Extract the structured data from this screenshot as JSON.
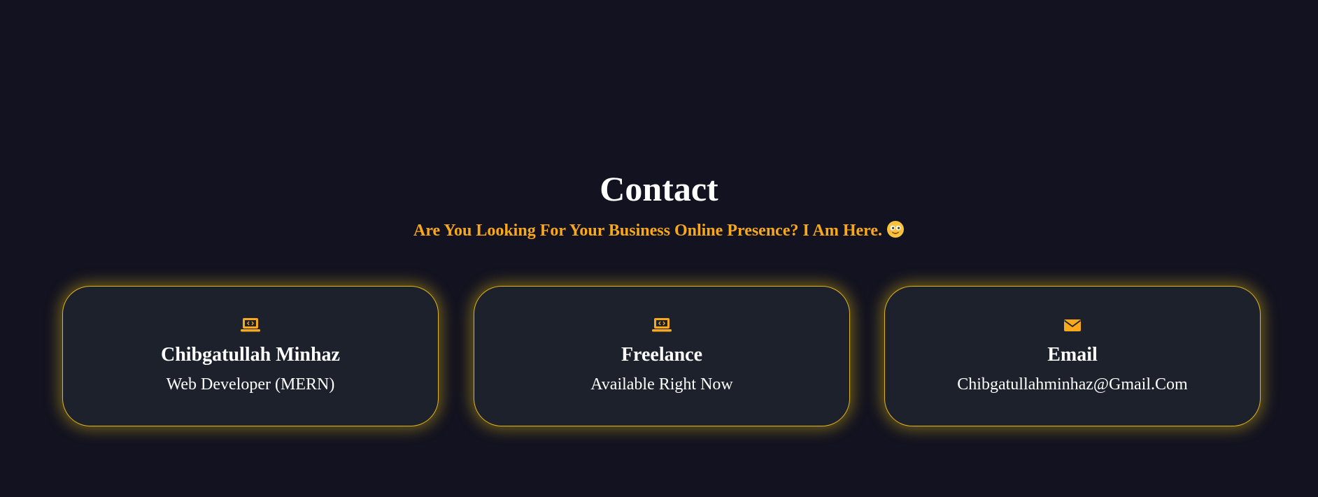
{
  "contact": {
    "title": "Contact",
    "subtitle": "Are You Looking For Your Business Online Presence? I Am Here.",
    "subtitle_emoji": "smiling-face-emoji",
    "accent_color": "#f7a81b",
    "background_color": "#121220",
    "card_background": "#1c212b",
    "cards": [
      {
        "icon": "laptop-code-icon",
        "heading": "Chibgatullah Minhaz",
        "text": "Web Developer (MERN)"
      },
      {
        "icon": "laptop-code-icon",
        "heading": "Freelance",
        "text": "Available Right Now"
      },
      {
        "icon": "envelope-icon",
        "heading": "Email",
        "text": "Chibgatullahminhaz@Gmail.Com"
      }
    ]
  }
}
